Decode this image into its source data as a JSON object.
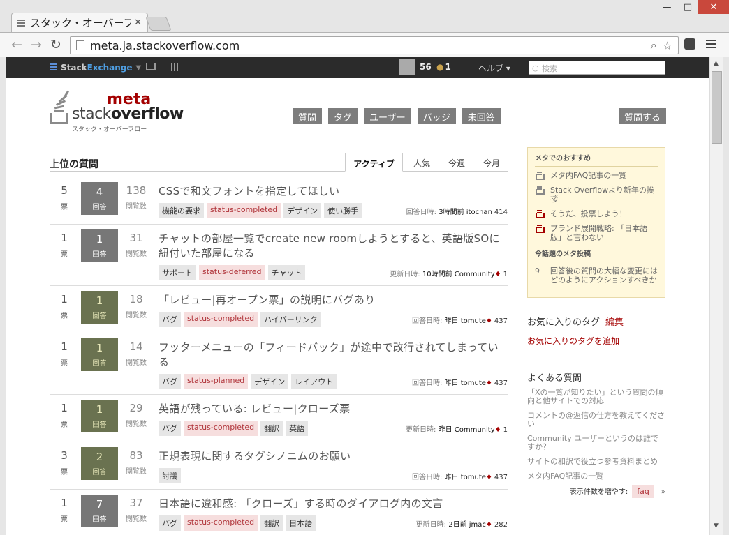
{
  "browser": {
    "tab_title": "スタック・オーバーフロ",
    "url": "meta.ja.stackoverflow.com",
    "minimize": "—",
    "maximize": "□",
    "close": "✕"
  },
  "topbar": {
    "brand_stack": "Stack",
    "brand_exchange": "Exchange",
    "reputation": "56",
    "badge_count": "1",
    "help": "ヘルプ ▾",
    "search_placeholder": "検索"
  },
  "header": {
    "logo_meta": "meta",
    "logo_stack": "stack",
    "logo_overflow": "overflow",
    "logo_sub": "スタック・オーバーフロー",
    "nav": [
      "質問",
      "タグ",
      "ユーザー",
      "バッジ",
      "未回答"
    ],
    "ask": "質問する"
  },
  "main": {
    "title": "上位の質問",
    "tabs": [
      "アクティブ",
      "人気",
      "今週",
      "今月"
    ]
  },
  "questions": [
    {
      "votes": "5",
      "votes_label": "票",
      "answers": "4",
      "answers_label": "回答",
      "accepted": false,
      "views": "138",
      "views_label": "閲覧数",
      "title": "CSSで和文フォントを指定してほしい",
      "tags": [
        {
          "t": "機能の要求"
        },
        {
          "t": "status-completed",
          "s": true
        },
        {
          "t": "デザイン"
        },
        {
          "t": "使い勝手"
        }
      ],
      "when_label": "回答日時:",
      "when": "3時間前",
      "user": "itochan",
      "mod": false,
      "rep": "414"
    },
    {
      "votes": "1",
      "votes_label": "票",
      "answers": "1",
      "answers_label": "回答",
      "accepted": false,
      "views": "31",
      "views_label": "閲覧数",
      "title": "チャットの部屋一覧でcreate new roomしようとすると、英語版SOに紐付いた部屋になる",
      "tags": [
        {
          "t": "サポート"
        },
        {
          "t": "status-deferred",
          "s": true
        },
        {
          "t": "チャット"
        }
      ],
      "when_label": "更新日時:",
      "when": "10時間前",
      "user": "Community",
      "mod": true,
      "rep": "1"
    },
    {
      "votes": "1",
      "votes_label": "票",
      "answers": "1",
      "answers_label": "回答",
      "accepted": true,
      "views": "18",
      "views_label": "閲覧数",
      "title": "「レビュー|再オープン票」の説明にバグあり",
      "tags": [
        {
          "t": "バグ"
        },
        {
          "t": "status-completed",
          "s": true
        },
        {
          "t": "ハイパーリンク"
        }
      ],
      "when_label": "回答日時:",
      "when": "昨日",
      "user": "tomute",
      "mod": true,
      "rep": "437"
    },
    {
      "votes": "1",
      "votes_label": "票",
      "answers": "1",
      "answers_label": "回答",
      "accepted": true,
      "views": "14",
      "views_label": "閲覧数",
      "title": "フッターメニューの「フィードバック」が途中で改行されてしまっている",
      "tags": [
        {
          "t": "バグ"
        },
        {
          "t": "status-planned",
          "s": true
        },
        {
          "t": "デザイン"
        },
        {
          "t": "レイアウト"
        }
      ],
      "when_label": "回答日時:",
      "when": "昨日",
      "user": "tomute",
      "mod": true,
      "rep": "437"
    },
    {
      "votes": "1",
      "votes_label": "票",
      "answers": "1",
      "answers_label": "回答",
      "accepted": true,
      "views": "29",
      "views_label": "閲覧数",
      "title": "英語が残っている: レビュー|クローズ票",
      "tags": [
        {
          "t": "バグ"
        },
        {
          "t": "status-completed",
          "s": true
        },
        {
          "t": "翻訳"
        },
        {
          "t": "英語"
        }
      ],
      "when_label": "更新日時:",
      "when": "昨日",
      "user": "Community",
      "mod": true,
      "rep": "1"
    },
    {
      "votes": "3",
      "votes_label": "票",
      "answers": "2",
      "answers_label": "回答",
      "accepted": true,
      "views": "83",
      "views_label": "閲覧数",
      "title": "正規表現に関するタグシノニムのお願い",
      "tags": [
        {
          "t": "討議"
        }
      ],
      "when_label": "回答日時:",
      "when": "昨日",
      "user": "tomute",
      "mod": true,
      "rep": "437"
    },
    {
      "votes": "1",
      "votes_label": "票",
      "answers": "7",
      "answers_label": "回答",
      "accepted": false,
      "views": "37",
      "views_label": "閲覧数",
      "title": "日本語に違和感: 「クローズ」する時のダイアログ内の文言",
      "tags": [
        {
          "t": "バグ"
        },
        {
          "t": "status-completed",
          "s": true
        },
        {
          "t": "翻訳"
        },
        {
          "t": "日本語"
        }
      ],
      "when_label": "更新日時:",
      "when": "2日前",
      "user": "jmac",
      "mod": true,
      "rep": "282"
    }
  ],
  "sidebar": {
    "featured_title": "メタでのおすすめ",
    "featured": [
      {
        "t": "メタ内FAQ記事の一覧",
        "hot": false
      },
      {
        "t": "Stack Overflowより新年の挨拶",
        "hot": false
      },
      {
        "t": "そうだ、投票しよう！",
        "hot": true
      },
      {
        "t": "ブランド展開戦略: 「日本語版」と言わない",
        "hot": true
      }
    ],
    "hot_title": "今話題のメタ投稿",
    "hot": [
      {
        "n": "9",
        "t": "回答後の質問の大幅な変更にはどのようにアクションすべきか"
      }
    ],
    "fav_title": "お気に入りのタグ",
    "fav_edit": "編集",
    "fav_add": "お気に入りのタグを追加",
    "faq_title": "よくある質問",
    "faq": [
      "「Xの一覧が知りたい」という質問の傾向と他サイトでの対応",
      "コメントの@返信の仕方を教えてください",
      "Community ユーザーというのは誰ですか？",
      "サイトの和訳で役立つ参考資料まとめ",
      "メタ内FAQ記事の一覧"
    ],
    "more_label": "表示件数を増やす:",
    "more_tag": "faq",
    "more_arrow": "»"
  }
}
